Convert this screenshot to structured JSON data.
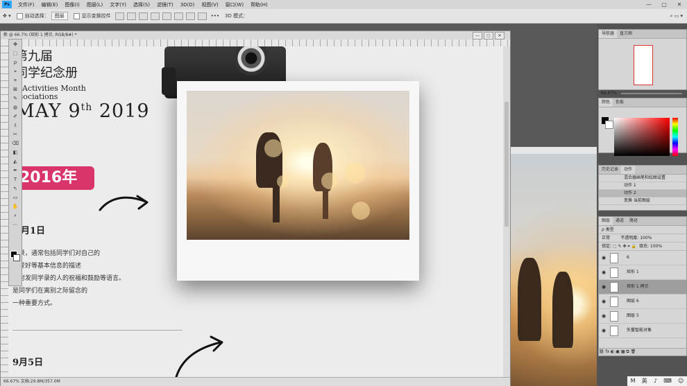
{
  "menu": {
    "logo": "Ps",
    "items": [
      "文件(F)",
      "编辑(E)",
      "图像(I)",
      "图层(L)",
      "文字(Y)",
      "选择(S)",
      "滤镜(T)",
      "3D(D)",
      "视图(V)",
      "窗口(W)",
      "帮助(H)"
    ],
    "window_controls": [
      "—",
      "▢",
      "✕"
    ]
  },
  "options": {
    "auto_select_label": "自动选择：",
    "auto_select_value": "图层",
    "show_transform_label": "显示变换控件",
    "mode_label": "3D 模式：",
    "more": "•••"
  },
  "document": {
    "title": "新 @ 66.7% (矩形 1 拷贝, RGB/8#) *",
    "status": "66.67%     文档:29.8M/357.0M",
    "controls": [
      "—",
      "▢",
      "✕"
    ]
  },
  "content": {
    "title_line1": "第九届",
    "title_line2": "同学纪念册",
    "subtitle_line1": "e Activities Month",
    "subtitle_line2": "ssociations",
    "date_main": "MAY 9",
    "date_sup": "th",
    "date_year": " 2019",
    "badge": "2016年",
    "date1": "月1日",
    "para": [
      "学录，通常包括同学们对自己的",
      "趣爱好等基本信息的描述",
      "及对发同学录的人的祝福和鼓励等语言。",
      "是同学们在离别之际留念的",
      "一种重要方式。"
    ],
    "date2": "9月5日"
  },
  "toolbar": {
    "tools": [
      "✥",
      "⬚",
      "ρ",
      "⌖",
      "⌗",
      "⊠",
      "✎",
      "◍",
      "✐",
      "⇩",
      "✂",
      "⌫",
      "◧",
      "◭",
      "✒",
      "T",
      "↖",
      "▭",
      "✋",
      "⌕",
      "⋯"
    ]
  },
  "panels": {
    "navigator": {
      "tabs": [
        "导航器",
        "直方图"
      ],
      "zoom": "66.67%"
    },
    "color": {
      "tabs": [
        "颜色",
        "色板"
      ]
    },
    "history": {
      "tabs": [
        "历史记录",
        "动作"
      ],
      "rows": [
        "混合器画笔和绘图设置",
        "动作 1",
        "动作 2",
        "变换 当前图层"
      ]
    },
    "layers": {
      "tabs": [
        "图层",
        "通道",
        "路径"
      ],
      "kind": "ρ 类型",
      "blend": "正常",
      "opacity_label": "不透明度:",
      "opacity": "100%",
      "lock_label": "锁定:",
      "fill_label": "填充:",
      "fill": "100%",
      "rows": [
        "6",
        "矩形 1",
        "矩形 1 拷贝",
        "图层 6",
        "图层 5",
        "矢量智能对象"
      ],
      "selected_index": 2,
      "footer": "⛓ fx ◐ ▣ ▦ ⧉ 🗑"
    }
  },
  "tray": {
    "items": [
      "M",
      "英",
      "♪",
      "⌨",
      "☺"
    ]
  }
}
